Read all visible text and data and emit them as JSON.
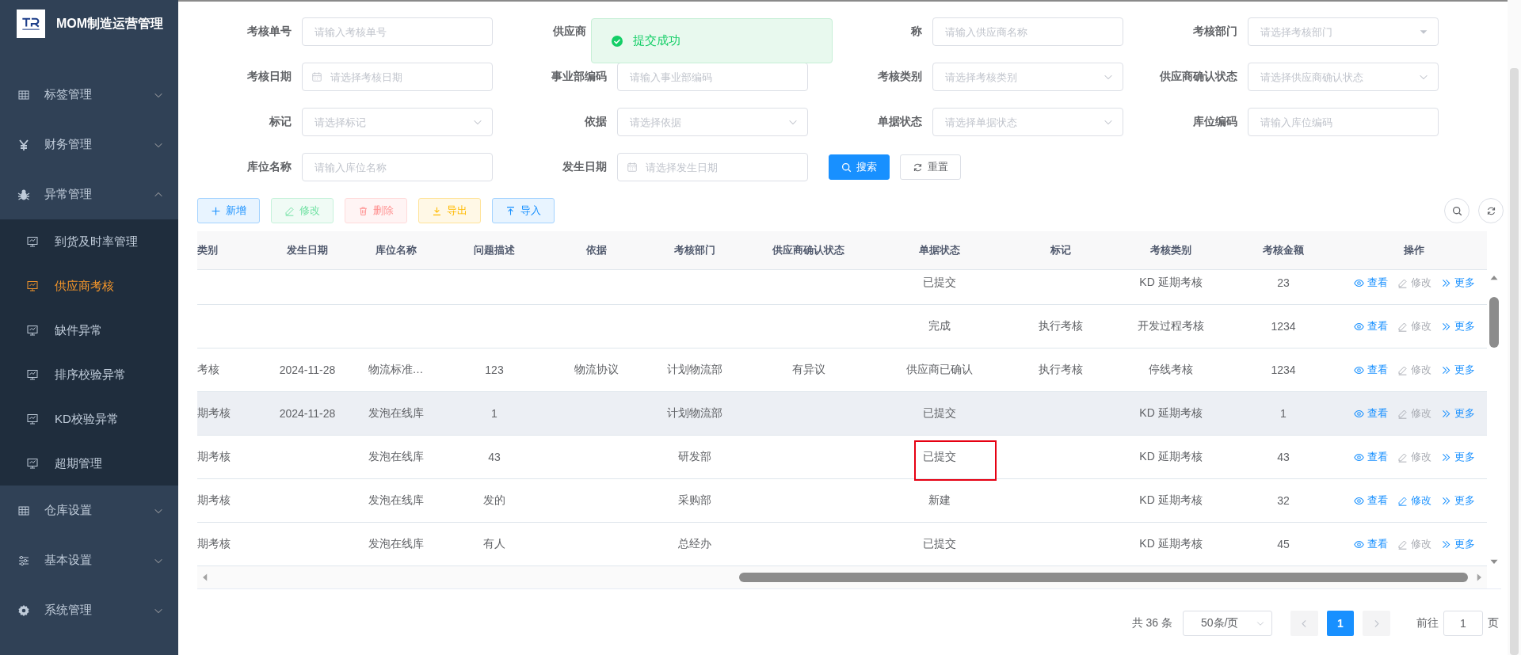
{
  "sidebar": {
    "title": "MOM制造运营管理",
    "items": [
      {
        "label": "标签管理",
        "expanded": false
      },
      {
        "label": "财务管理",
        "expanded": false
      },
      {
        "label": "异常管理",
        "expanded": true,
        "children": [
          {
            "label": "到货及时率管理",
            "selected": false
          },
          {
            "label": "供应商考核",
            "selected": true
          },
          {
            "label": "缺件异常",
            "selected": false
          },
          {
            "label": "排序校验异常",
            "selected": false
          },
          {
            "label": "KD校验异常",
            "selected": false
          },
          {
            "label": "超期管理",
            "selected": false
          }
        ]
      },
      {
        "label": "仓库设置",
        "expanded": false
      },
      {
        "label": "基本设置",
        "expanded": false
      },
      {
        "label": "系统管理",
        "expanded": false
      }
    ]
  },
  "toast": {
    "message": "提交成功"
  },
  "filters": [
    {
      "label": "考核单号",
      "kind": "input",
      "placeholder": "请输入考核单号"
    },
    {
      "label": "供应商",
      "kind": "covered"
    },
    {
      "label": "称",
      "kind": "input",
      "placeholder": "请输入供应商名称"
    },
    {
      "label": "考核部门",
      "kind": "dropdown",
      "placeholder": "请选择考核部门"
    },
    {
      "label": "考核日期",
      "kind": "date",
      "placeholder": "请选择考核日期"
    },
    {
      "label": "事业部编码",
      "kind": "input",
      "placeholder": "请输入事业部编码"
    },
    {
      "label": "考核类别",
      "kind": "select",
      "placeholder": "请选择考核类别"
    },
    {
      "label": "供应商确认状态",
      "kind": "select",
      "placeholder": "请选择供应商确认状态"
    },
    {
      "label": "标记",
      "kind": "select",
      "placeholder": "请选择标记"
    },
    {
      "label": "依据",
      "kind": "select",
      "placeholder": "请选择依据"
    },
    {
      "label": "单据状态",
      "kind": "select",
      "placeholder": "请选择单据状态"
    },
    {
      "label": "库位编码",
      "kind": "input",
      "placeholder": "请输入库位编码"
    },
    {
      "label": "库位名称",
      "kind": "input",
      "placeholder": "请输入库位名称"
    },
    {
      "label": "发生日期",
      "kind": "date",
      "placeholder": "请选择发生日期"
    }
  ],
  "search_button": "搜索",
  "reset_button": "重置",
  "toolbar": [
    {
      "label": "新增",
      "kind": "add",
      "disabled": false
    },
    {
      "label": "修改",
      "kind": "edit",
      "disabled": true
    },
    {
      "label": "删除",
      "kind": "delete",
      "disabled": true
    },
    {
      "label": "导出",
      "kind": "export",
      "disabled": false
    },
    {
      "label": "导入",
      "kind": "import",
      "disabled": false
    }
  ],
  "table": {
    "columns": [
      {
        "kind": "text",
        "label": "类别"
      },
      {
        "kind": "text",
        "label": "发生日期"
      },
      {
        "kind": "text",
        "label": "库位名称"
      },
      {
        "kind": "text",
        "label": "问题描述"
      },
      {
        "kind": "text",
        "label": "依据"
      },
      {
        "kind": "text",
        "label": "考核部门"
      },
      {
        "kind": "text",
        "label": "供应商确认状态"
      },
      {
        "kind": "status",
        "label": "单据状态"
      },
      {
        "kind": "text",
        "label": "标记"
      },
      {
        "kind": "text",
        "label": "考核类别"
      },
      {
        "kind": "text",
        "label": "考核金额"
      },
      {
        "kind": "actions",
        "label": "操作"
      }
    ],
    "rows": [
      {
        "hovered": false,
        "highlighted": false,
        "cells": [
          null,
          null,
          null,
          null,
          null,
          null,
          null,
          "已提交",
          null,
          "KD 延期考核",
          "23"
        ],
        "actions": [
          {
            "kind": "view",
            "label": "查看",
            "disabled": false
          },
          {
            "kind": "edit",
            "label": "修改",
            "disabled": true
          },
          {
            "kind": "more",
            "label": "更多",
            "disabled": false
          }
        ]
      },
      {
        "hovered": false,
        "highlighted": false,
        "cells": [
          null,
          null,
          null,
          null,
          null,
          null,
          null,
          "完成",
          "执行考核",
          "开发过程考核",
          "1234"
        ],
        "actions": [
          {
            "kind": "view",
            "label": "查看",
            "disabled": false
          },
          {
            "kind": "edit",
            "label": "修改",
            "disabled": true
          },
          {
            "kind": "more",
            "label": "更多",
            "disabled": false
          }
        ]
      },
      {
        "hovered": false,
        "highlighted": false,
        "cells": [
          "考核",
          "2024-11-28",
          "物流标准…",
          "123",
          "物流协议",
          "计划物流部",
          "有异议",
          "供应商已确认",
          "执行考核",
          "停线考核",
          "1234"
        ],
        "actions": [
          {
            "kind": "view",
            "label": "查看",
            "disabled": false
          },
          {
            "kind": "edit",
            "label": "修改",
            "disabled": true
          },
          {
            "kind": "more",
            "label": "更多",
            "disabled": false
          }
        ]
      },
      {
        "hovered": true,
        "highlighted": false,
        "cells": [
          "期考核",
          "2024-11-28",
          "发泡在线库",
          "1",
          null,
          "计划物流部",
          null,
          "已提交",
          null,
          "KD 延期考核",
          "1"
        ],
        "actions": [
          {
            "kind": "view",
            "label": "查看",
            "disabled": false
          },
          {
            "kind": "edit",
            "label": "修改",
            "disabled": true
          },
          {
            "kind": "more",
            "label": "更多",
            "disabled": false
          }
        ]
      },
      {
        "hovered": false,
        "highlighted": true,
        "cells": [
          "期考核",
          null,
          "发泡在线库",
          "43",
          null,
          "研发部",
          null,
          "已提交",
          null,
          "KD 延期考核",
          "43"
        ],
        "actions": [
          {
            "kind": "view",
            "label": "查看",
            "disabled": false
          },
          {
            "kind": "edit",
            "label": "修改",
            "disabled": true
          },
          {
            "kind": "more",
            "label": "更多",
            "disabled": false
          }
        ]
      },
      {
        "hovered": false,
        "highlighted": false,
        "cells": [
          "期考核",
          null,
          "发泡在线库",
          "发的",
          null,
          "采购部",
          null,
          "新建",
          null,
          "KD 延期考核",
          "32"
        ],
        "actions": [
          {
            "kind": "view",
            "label": "查看",
            "disabled": false
          },
          {
            "kind": "edit",
            "label": "修改",
            "disabled": false
          },
          {
            "kind": "more",
            "label": "更多",
            "disabled": false
          }
        ]
      },
      {
        "hovered": false,
        "highlighted": false,
        "cells": [
          "期考核",
          null,
          "发泡在线库",
          "有人",
          null,
          "总经办",
          null,
          "已提交",
          null,
          "KD 延期考核",
          "45"
        ],
        "actions": [
          {
            "kind": "view",
            "label": "查看",
            "disabled": false
          },
          {
            "kind": "edit",
            "label": "修改",
            "disabled": true
          },
          {
            "kind": "more",
            "label": "更多",
            "disabled": false
          }
        ]
      }
    ]
  },
  "pagination": {
    "total": "共 36 条",
    "page_size": "50条/页",
    "pages": [
      {
        "label": "1",
        "selected": true
      }
    ],
    "goto_label": "前往",
    "goto_value": "1",
    "page_suffix": "页"
  }
}
